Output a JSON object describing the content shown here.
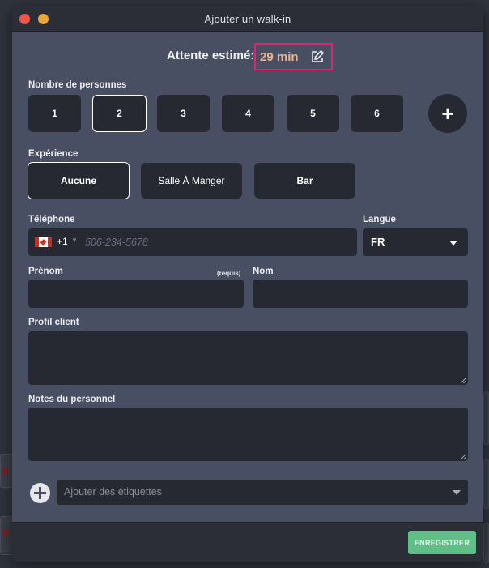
{
  "window": {
    "title": "Ajouter un walk-in"
  },
  "wait": {
    "label": "Attente estimé:",
    "value": "29 min"
  },
  "party_size": {
    "label": "Nombre de personnes",
    "options": [
      "1",
      "2",
      "3",
      "4",
      "5",
      "6"
    ],
    "selected": "2",
    "more_label": "+"
  },
  "experience": {
    "label": "Expérience",
    "options": [
      "Aucune",
      "Salle À Manger",
      "Bar"
    ],
    "selected": "Aucune"
  },
  "phone": {
    "label": "Téléphone",
    "country_code": "+1",
    "placeholder": "506-234-5678",
    "value": ""
  },
  "language": {
    "label": "Langue",
    "value": "FR"
  },
  "first_name": {
    "label": "Prénom",
    "required_note": "(requis)",
    "value": ""
  },
  "last_name": {
    "label": "Nom",
    "value": ""
  },
  "profile": {
    "label": "Profil client",
    "value": ""
  },
  "staff_notes": {
    "label": "Notes du personnel",
    "value": ""
  },
  "tags": {
    "placeholder": "Ajouter des étiquettes"
  },
  "footer": {
    "save_label": "ENREGISTRER"
  },
  "colors": {
    "accent_highlight": "#e0246f",
    "wait_value": "#e8b38e",
    "save_button": "#5fbf86",
    "panel": "#494f62",
    "field": "#262832"
  }
}
